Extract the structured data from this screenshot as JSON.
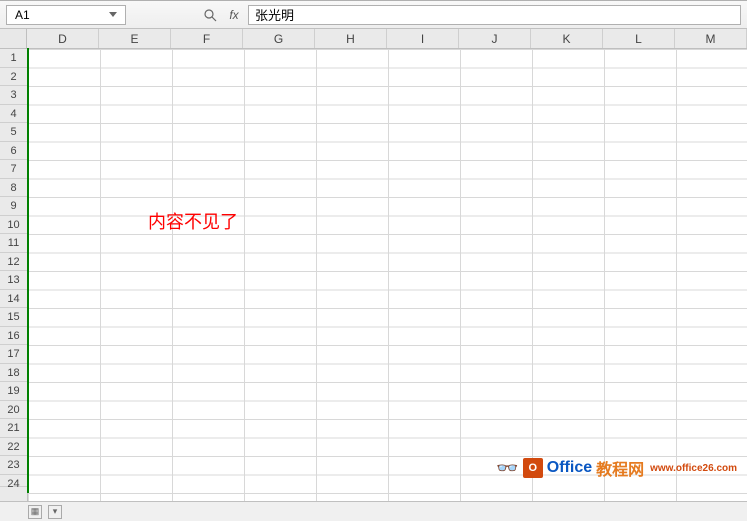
{
  "formulaBar": {
    "nameBox": "A1",
    "fxLabel": "fx",
    "formulaValue": "张光明"
  },
  "columns": [
    "D",
    "E",
    "F",
    "G",
    "H",
    "I",
    "J",
    "K",
    "L",
    "M"
  ],
  "rows": [
    "1",
    "2",
    "3",
    "4",
    "5",
    "6",
    "7",
    "8",
    "9",
    "10",
    "11",
    "12",
    "13",
    "14",
    "15",
    "16",
    "17",
    "18",
    "19",
    "20",
    "21",
    "22",
    "23",
    "24"
  ],
  "annotation": "内容不见了",
  "watermark": {
    "logoLetter": "O",
    "brand": "Office",
    "brandSuffix": "教程网",
    "sub": "www.office26.com"
  },
  "activeCell": "A1"
}
